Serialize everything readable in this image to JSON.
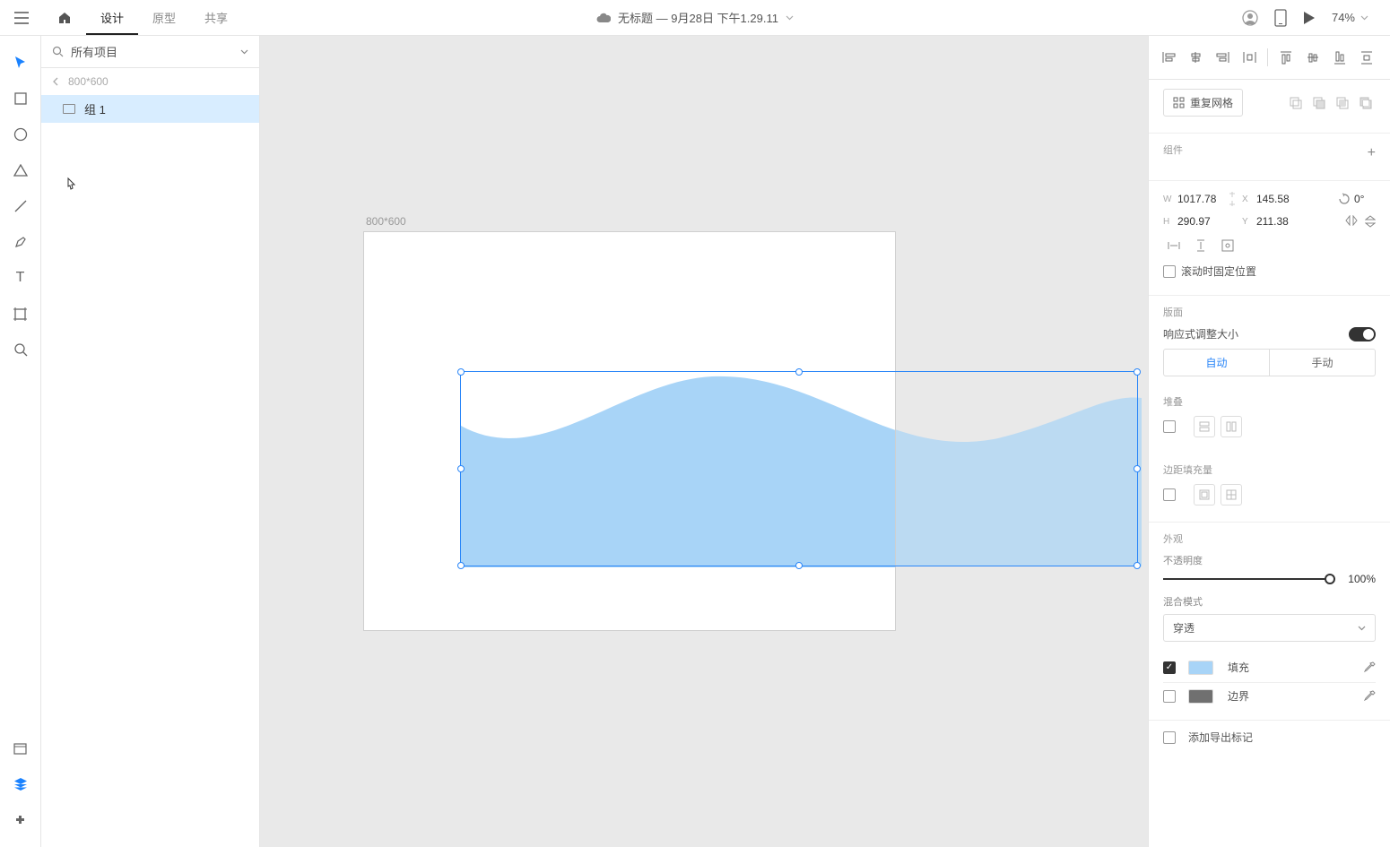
{
  "header": {
    "tabs": {
      "design": "设计",
      "prototype": "原型",
      "share": "共享"
    },
    "doc_title": "无标题 — 9月28日 下午1.29.11",
    "zoom": "74%"
  },
  "left_panel": {
    "filter": "所有项目",
    "breadcrumb": "800*600",
    "layer1": "组 1"
  },
  "canvas": {
    "artboard_label": "800*600"
  },
  "props": {
    "repeat_grid": "重复网格",
    "components_label": "组件",
    "w": "1017.78",
    "h": "290.97",
    "x": "145.58",
    "y": "211.38",
    "rotation": "0°",
    "fix_scroll": "滚动时固定位置",
    "layout_label": "版面",
    "responsive_resize": "响应式调整大小",
    "auto": "自动",
    "manual": "手动",
    "stack_label": "堆叠",
    "scroll_label": "边距填充量",
    "appearance_label": "外观",
    "opacity_label": "不透明度",
    "opacity_value": "100%",
    "blend_label": "混合模式",
    "blend_mode": "穿透",
    "fill_label": "填充",
    "border_label": "边界",
    "export_label": "添加导出标记"
  },
  "colors": {
    "fill": "#a8d4f7",
    "border": "#707070"
  }
}
